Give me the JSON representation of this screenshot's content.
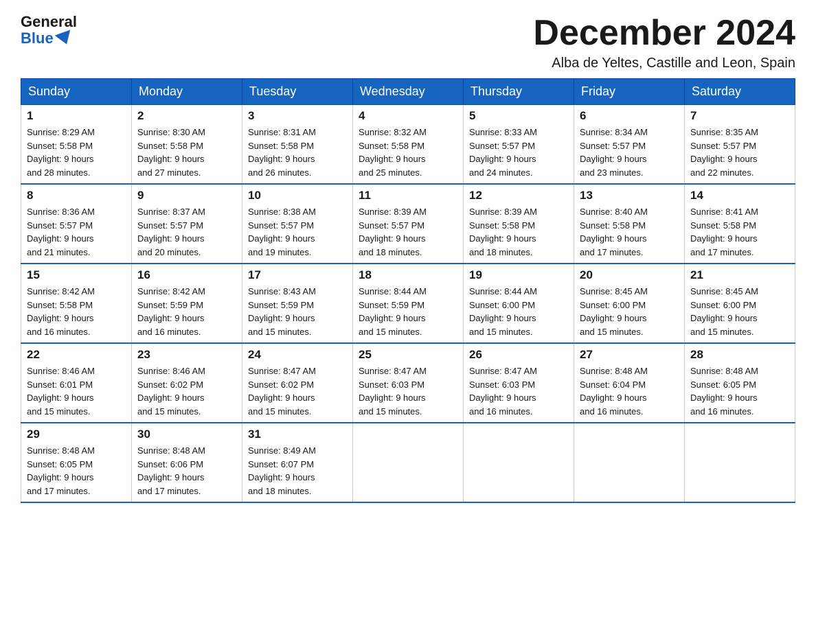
{
  "header": {
    "logo_general": "General",
    "logo_blue": "Blue",
    "month_title": "December 2024",
    "subtitle": "Alba de Yeltes, Castille and Leon, Spain"
  },
  "days_of_week": [
    "Sunday",
    "Monday",
    "Tuesday",
    "Wednesday",
    "Thursday",
    "Friday",
    "Saturday"
  ],
  "weeks": [
    [
      {
        "day": "1",
        "sunrise": "8:29 AM",
        "sunset": "5:58 PM",
        "daylight": "9 hours and 28 minutes."
      },
      {
        "day": "2",
        "sunrise": "8:30 AM",
        "sunset": "5:58 PM",
        "daylight": "9 hours and 27 minutes."
      },
      {
        "day": "3",
        "sunrise": "8:31 AM",
        "sunset": "5:58 PM",
        "daylight": "9 hours and 26 minutes."
      },
      {
        "day": "4",
        "sunrise": "8:32 AM",
        "sunset": "5:58 PM",
        "daylight": "9 hours and 25 minutes."
      },
      {
        "day": "5",
        "sunrise": "8:33 AM",
        "sunset": "5:57 PM",
        "daylight": "9 hours and 24 minutes."
      },
      {
        "day": "6",
        "sunrise": "8:34 AM",
        "sunset": "5:57 PM",
        "daylight": "9 hours and 23 minutes."
      },
      {
        "day": "7",
        "sunrise": "8:35 AM",
        "sunset": "5:57 PM",
        "daylight": "9 hours and 22 minutes."
      }
    ],
    [
      {
        "day": "8",
        "sunrise": "8:36 AM",
        "sunset": "5:57 PM",
        "daylight": "9 hours and 21 minutes."
      },
      {
        "day": "9",
        "sunrise": "8:37 AM",
        "sunset": "5:57 PM",
        "daylight": "9 hours and 20 minutes."
      },
      {
        "day": "10",
        "sunrise": "8:38 AM",
        "sunset": "5:57 PM",
        "daylight": "9 hours and 19 minutes."
      },
      {
        "day": "11",
        "sunrise": "8:39 AM",
        "sunset": "5:57 PM",
        "daylight": "9 hours and 18 minutes."
      },
      {
        "day": "12",
        "sunrise": "8:39 AM",
        "sunset": "5:58 PM",
        "daylight": "9 hours and 18 minutes."
      },
      {
        "day": "13",
        "sunrise": "8:40 AM",
        "sunset": "5:58 PM",
        "daylight": "9 hours and 17 minutes."
      },
      {
        "day": "14",
        "sunrise": "8:41 AM",
        "sunset": "5:58 PM",
        "daylight": "9 hours and 17 minutes."
      }
    ],
    [
      {
        "day": "15",
        "sunrise": "8:42 AM",
        "sunset": "5:58 PM",
        "daylight": "9 hours and 16 minutes."
      },
      {
        "day": "16",
        "sunrise": "8:42 AM",
        "sunset": "5:59 PM",
        "daylight": "9 hours and 16 minutes."
      },
      {
        "day": "17",
        "sunrise": "8:43 AM",
        "sunset": "5:59 PM",
        "daylight": "9 hours and 15 minutes."
      },
      {
        "day": "18",
        "sunrise": "8:44 AM",
        "sunset": "5:59 PM",
        "daylight": "9 hours and 15 minutes."
      },
      {
        "day": "19",
        "sunrise": "8:44 AM",
        "sunset": "6:00 PM",
        "daylight": "9 hours and 15 minutes."
      },
      {
        "day": "20",
        "sunrise": "8:45 AM",
        "sunset": "6:00 PM",
        "daylight": "9 hours and 15 minutes."
      },
      {
        "day": "21",
        "sunrise": "8:45 AM",
        "sunset": "6:00 PM",
        "daylight": "9 hours and 15 minutes."
      }
    ],
    [
      {
        "day": "22",
        "sunrise": "8:46 AM",
        "sunset": "6:01 PM",
        "daylight": "9 hours and 15 minutes."
      },
      {
        "day": "23",
        "sunrise": "8:46 AM",
        "sunset": "6:02 PM",
        "daylight": "9 hours and 15 minutes."
      },
      {
        "day": "24",
        "sunrise": "8:47 AM",
        "sunset": "6:02 PM",
        "daylight": "9 hours and 15 minutes."
      },
      {
        "day": "25",
        "sunrise": "8:47 AM",
        "sunset": "6:03 PM",
        "daylight": "9 hours and 15 minutes."
      },
      {
        "day": "26",
        "sunrise": "8:47 AM",
        "sunset": "6:03 PM",
        "daylight": "9 hours and 16 minutes."
      },
      {
        "day": "27",
        "sunrise": "8:48 AM",
        "sunset": "6:04 PM",
        "daylight": "9 hours and 16 minutes."
      },
      {
        "day": "28",
        "sunrise": "8:48 AM",
        "sunset": "6:05 PM",
        "daylight": "9 hours and 16 minutes."
      }
    ],
    [
      {
        "day": "29",
        "sunrise": "8:48 AM",
        "sunset": "6:05 PM",
        "daylight": "9 hours and 17 minutes."
      },
      {
        "day": "30",
        "sunrise": "8:48 AM",
        "sunset": "6:06 PM",
        "daylight": "9 hours and 17 minutes."
      },
      {
        "day": "31",
        "sunrise": "8:49 AM",
        "sunset": "6:07 PM",
        "daylight": "9 hours and 18 minutes."
      },
      null,
      null,
      null,
      null
    ]
  ],
  "labels": {
    "sunrise": "Sunrise:",
    "sunset": "Sunset:",
    "daylight": "Daylight:"
  }
}
